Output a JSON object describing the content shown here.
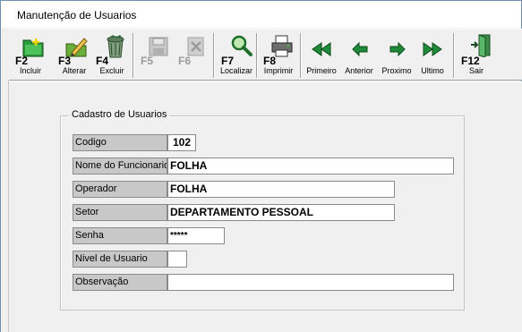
{
  "window": {
    "title": "Manutenção de Usuarios"
  },
  "toolbar": {
    "incluir": {
      "key": "F2",
      "label": "Incluir"
    },
    "alterar": {
      "key": "F3",
      "label": "Alterar"
    },
    "excluir": {
      "key": "F4",
      "label": "Excluir"
    },
    "salvar": {
      "key": "F5",
      "label": ""
    },
    "cancelar": {
      "key": "F6",
      "label": ""
    },
    "localizar": {
      "key": "F7",
      "label": "Localizar"
    },
    "imprimir": {
      "key": "F8",
      "label": "Imprimir"
    },
    "primeiro": {
      "label": "Primeiro"
    },
    "anterior": {
      "label": "Anterior"
    },
    "proximo": {
      "label": "Proximo"
    },
    "ultimo": {
      "label": "Ultimo"
    },
    "sair": {
      "key": "F12",
      "label": "Sair"
    }
  },
  "form": {
    "group_title": "Cadastro de Usuarios",
    "codigo": {
      "label": "Codigo",
      "value": "102"
    },
    "nome": {
      "label": "Nome do Funcionario",
      "value": "FOLHA"
    },
    "operador": {
      "label": "Operador",
      "value": "FOLHA"
    },
    "setor": {
      "label": "Setor",
      "value": "DEPARTAMENTO PESSOAL"
    },
    "senha": {
      "label": "Senha",
      "value": "*****"
    },
    "nivel": {
      "label": "Nivel de Usuario",
      "value": ""
    },
    "observacao": {
      "label": "Observação",
      "value": ""
    }
  },
  "colors": {
    "nav_green": "#1e8a3a",
    "label_bg": "#c8c8c8",
    "folder_green": "#2e9a3e"
  },
  "icons": [
    "folder-add-icon",
    "folder-edit-icon",
    "recycle-delete-icon",
    "save-disk-icon",
    "cancel-icon",
    "magnifier-icon",
    "printer-icon",
    "first-arrow-icon",
    "previous-arrow-icon",
    "next-arrow-icon",
    "last-arrow-icon",
    "exit-door-icon"
  ]
}
